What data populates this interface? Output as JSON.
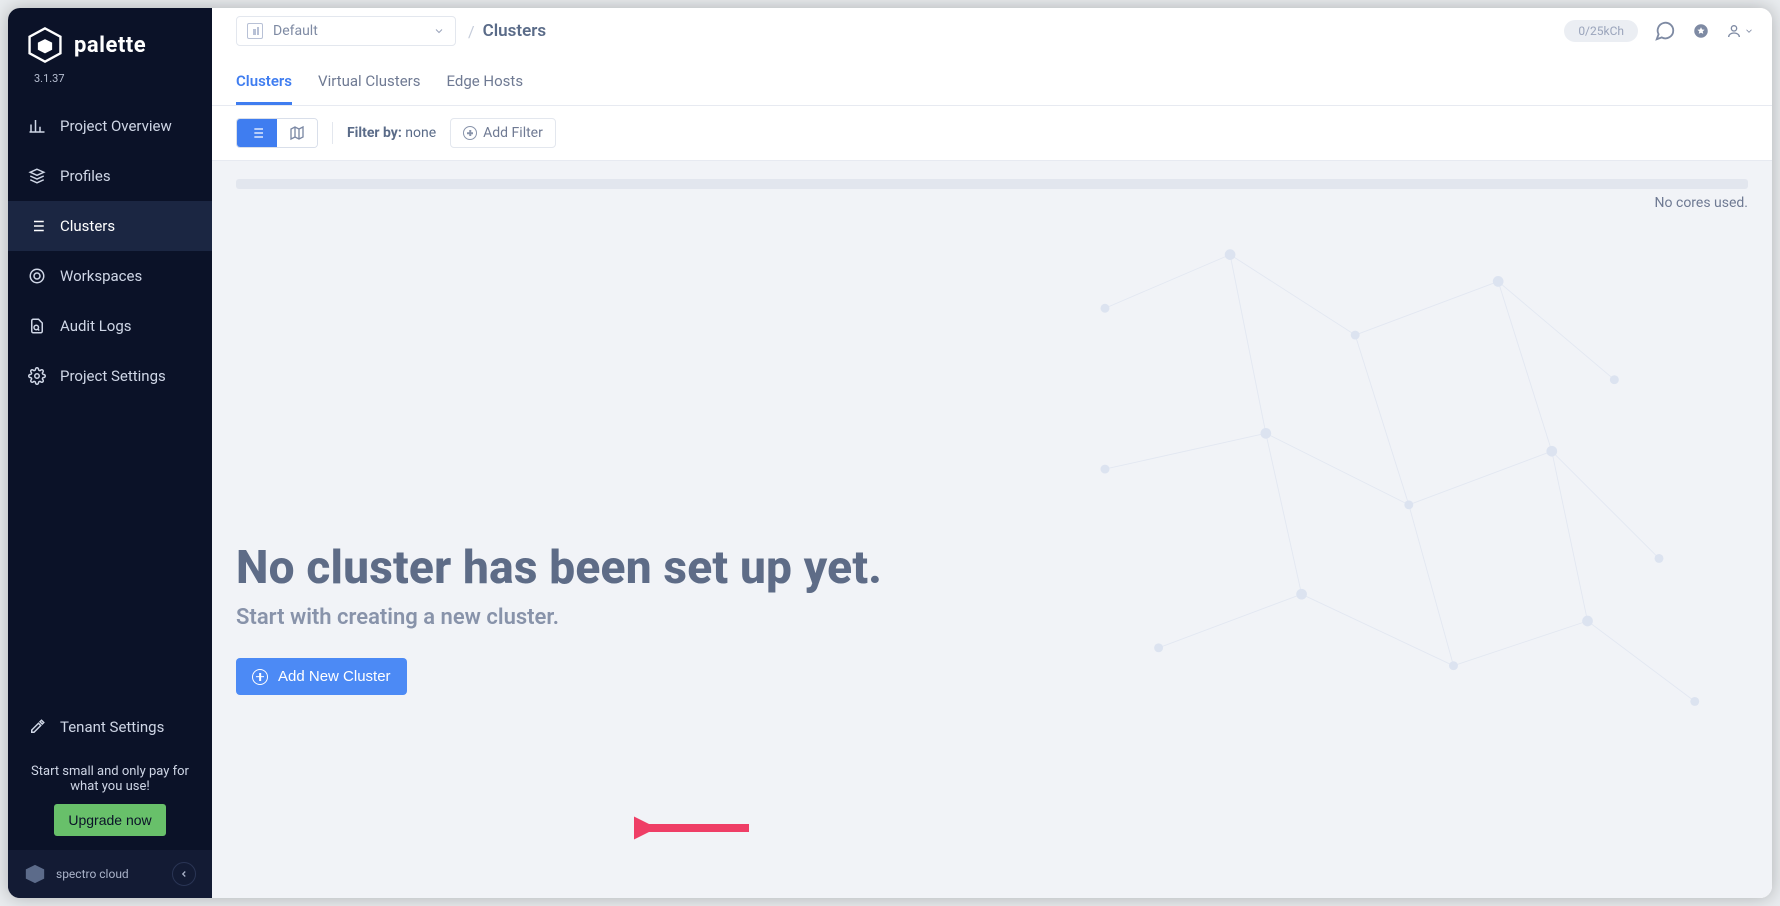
{
  "brand": {
    "name": "palette",
    "version": "3.1.37",
    "footer": "spectro cloud"
  },
  "sidebar": {
    "items": [
      {
        "label": "Project Overview",
        "icon": "chart"
      },
      {
        "label": "Profiles",
        "icon": "stack"
      },
      {
        "label": "Clusters",
        "icon": "list"
      },
      {
        "label": "Workspaces",
        "icon": "target"
      },
      {
        "label": "Audit Logs",
        "icon": "doc"
      },
      {
        "label": "Project Settings",
        "icon": "gear"
      }
    ],
    "tenant_settings": "Tenant Settings",
    "promo_text": "Start small and only pay for what you use!",
    "upgrade_label": "Upgrade now"
  },
  "top": {
    "project_selector": "Default",
    "breadcrumb": "Clusters",
    "quota": "0/25kCh"
  },
  "tabs": [
    {
      "label": "Clusters",
      "active": true
    },
    {
      "label": "Virtual Clusters",
      "active": false
    },
    {
      "label": "Edge Hosts",
      "active": false
    }
  ],
  "toolbar": {
    "filter_label": "Filter by:",
    "filter_value": "none",
    "add_filter_label": "Add Filter"
  },
  "cores_text": "No cores used.",
  "empty": {
    "title": "No cluster has been set up yet.",
    "subtitle": "Start with creating a new cluster.",
    "button_label": "Add New Cluster"
  }
}
